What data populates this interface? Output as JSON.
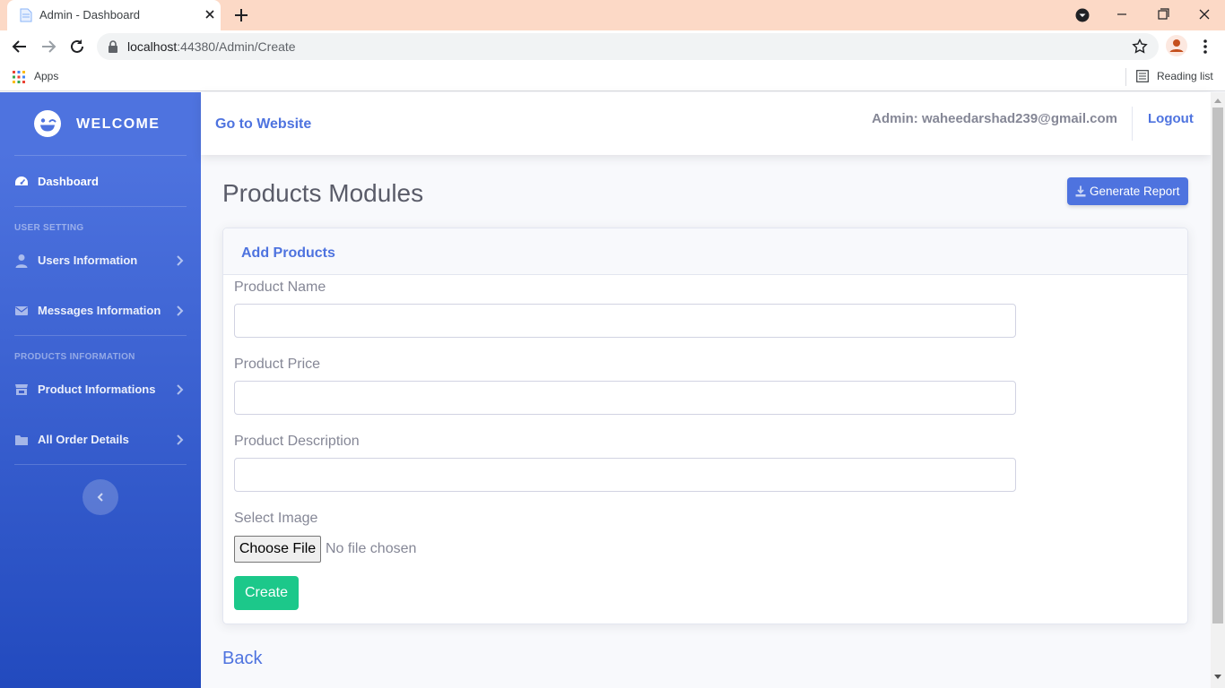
{
  "browser": {
    "tab_title": "Admin - Dashboard",
    "url_host": "localhost",
    "url_path": ":44380/Admin/Create",
    "bookmarks": {
      "apps_label": "Apps",
      "reading_list_label": "Reading list"
    }
  },
  "sidebar": {
    "brand": "WELCOME",
    "dashboard_label": "Dashboard",
    "heading_user_setting": "USER SETTING",
    "users_label": "Users Information",
    "messages_label": "Messages Information",
    "heading_products": "PRODUCTS INFORMATION",
    "products_label": "Product Informations",
    "orders_label": "All Order Details"
  },
  "topbar": {
    "goto_label": "Go to Website",
    "admin_label": "Admin: waheedarshad239@gmail.com",
    "logout_label": "Logout"
  },
  "main": {
    "page_title": "Products Modules",
    "report_button_label": "Generate Report",
    "card_title": "Add Products",
    "fields": {
      "name_label": "Product Name",
      "name_value": "",
      "price_label": "Product Price",
      "price_value": "",
      "description_label": "Product Description",
      "description_value": "",
      "image_label": "Select Image",
      "file_button_label": "Choose File",
      "file_status": "No file chosen"
    },
    "create_button_label": "Create",
    "back_link_label": "Back"
  },
  "colors": {
    "primary": "#4e73df",
    "success": "#1cc88a",
    "sidebar_gradient_end": "#224abe",
    "text_muted": "#858796",
    "tabstrip": "#fcd9c6"
  },
  "icons": {
    "brand": "laugh-wink-icon",
    "dashboard": "tachometer-icon",
    "users": "user-icon",
    "messages": "envelope-icon",
    "products": "store-icon",
    "orders": "folder-icon",
    "report": "download-icon"
  }
}
